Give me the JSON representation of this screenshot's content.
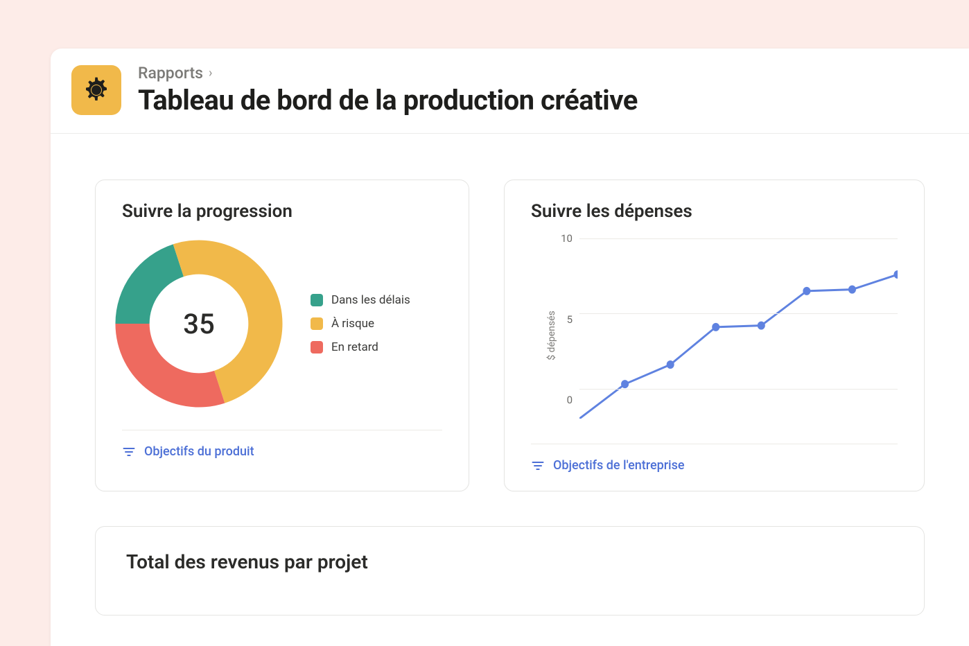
{
  "header": {
    "breadcrumb": "Rapports",
    "title": "Tableau de bord de la production créative"
  },
  "cards": {
    "progress": {
      "title": "Suivre la progression",
      "center_value": "35",
      "legend": [
        {
          "label": "Dans les délais",
          "color": "#36a18b"
        },
        {
          "label": "À risque",
          "color": "#f1b94a"
        },
        {
          "label": "En retard",
          "color": "#ee6a5f"
        }
      ],
      "filter_label": "Objectifs du produit"
    },
    "spending": {
      "title": "Suivre les dépenses",
      "ylabel": "$ dépensés",
      "yticks": [
        "10",
        "5",
        "0"
      ],
      "filter_label": "Objectifs de l'entreprise"
    },
    "revenue": {
      "title": "Total des revenus par projet"
    }
  },
  "colors": {
    "accent_blue": "#5f82e0",
    "grid": "#eceae6"
  },
  "chart_data": [
    {
      "type": "pie",
      "title": "Suivre la progression",
      "total_label": 35,
      "series": [
        {
          "name": "Dans les délais",
          "value": 20,
          "color": "#36a18b"
        },
        {
          "name": "À risque",
          "value": 50,
          "color": "#f1b94a"
        },
        {
          "name": "En retard",
          "value": 30,
          "color": "#ee6a5f"
        }
      ]
    },
    {
      "type": "line",
      "title": "Suivre les dépenses",
      "ylabel": "$ dépensés",
      "ylim": [
        -2,
        10
      ],
      "x": [
        0,
        1,
        2,
        3,
        4,
        5,
        6,
        7
      ],
      "series": [
        {
          "name": "dépenses",
          "values": [
            -2,
            0.3,
            1.6,
            4.1,
            4.2,
            6.5,
            6.6,
            7.6
          ],
          "color": "#5f82e0"
        }
      ]
    }
  ]
}
